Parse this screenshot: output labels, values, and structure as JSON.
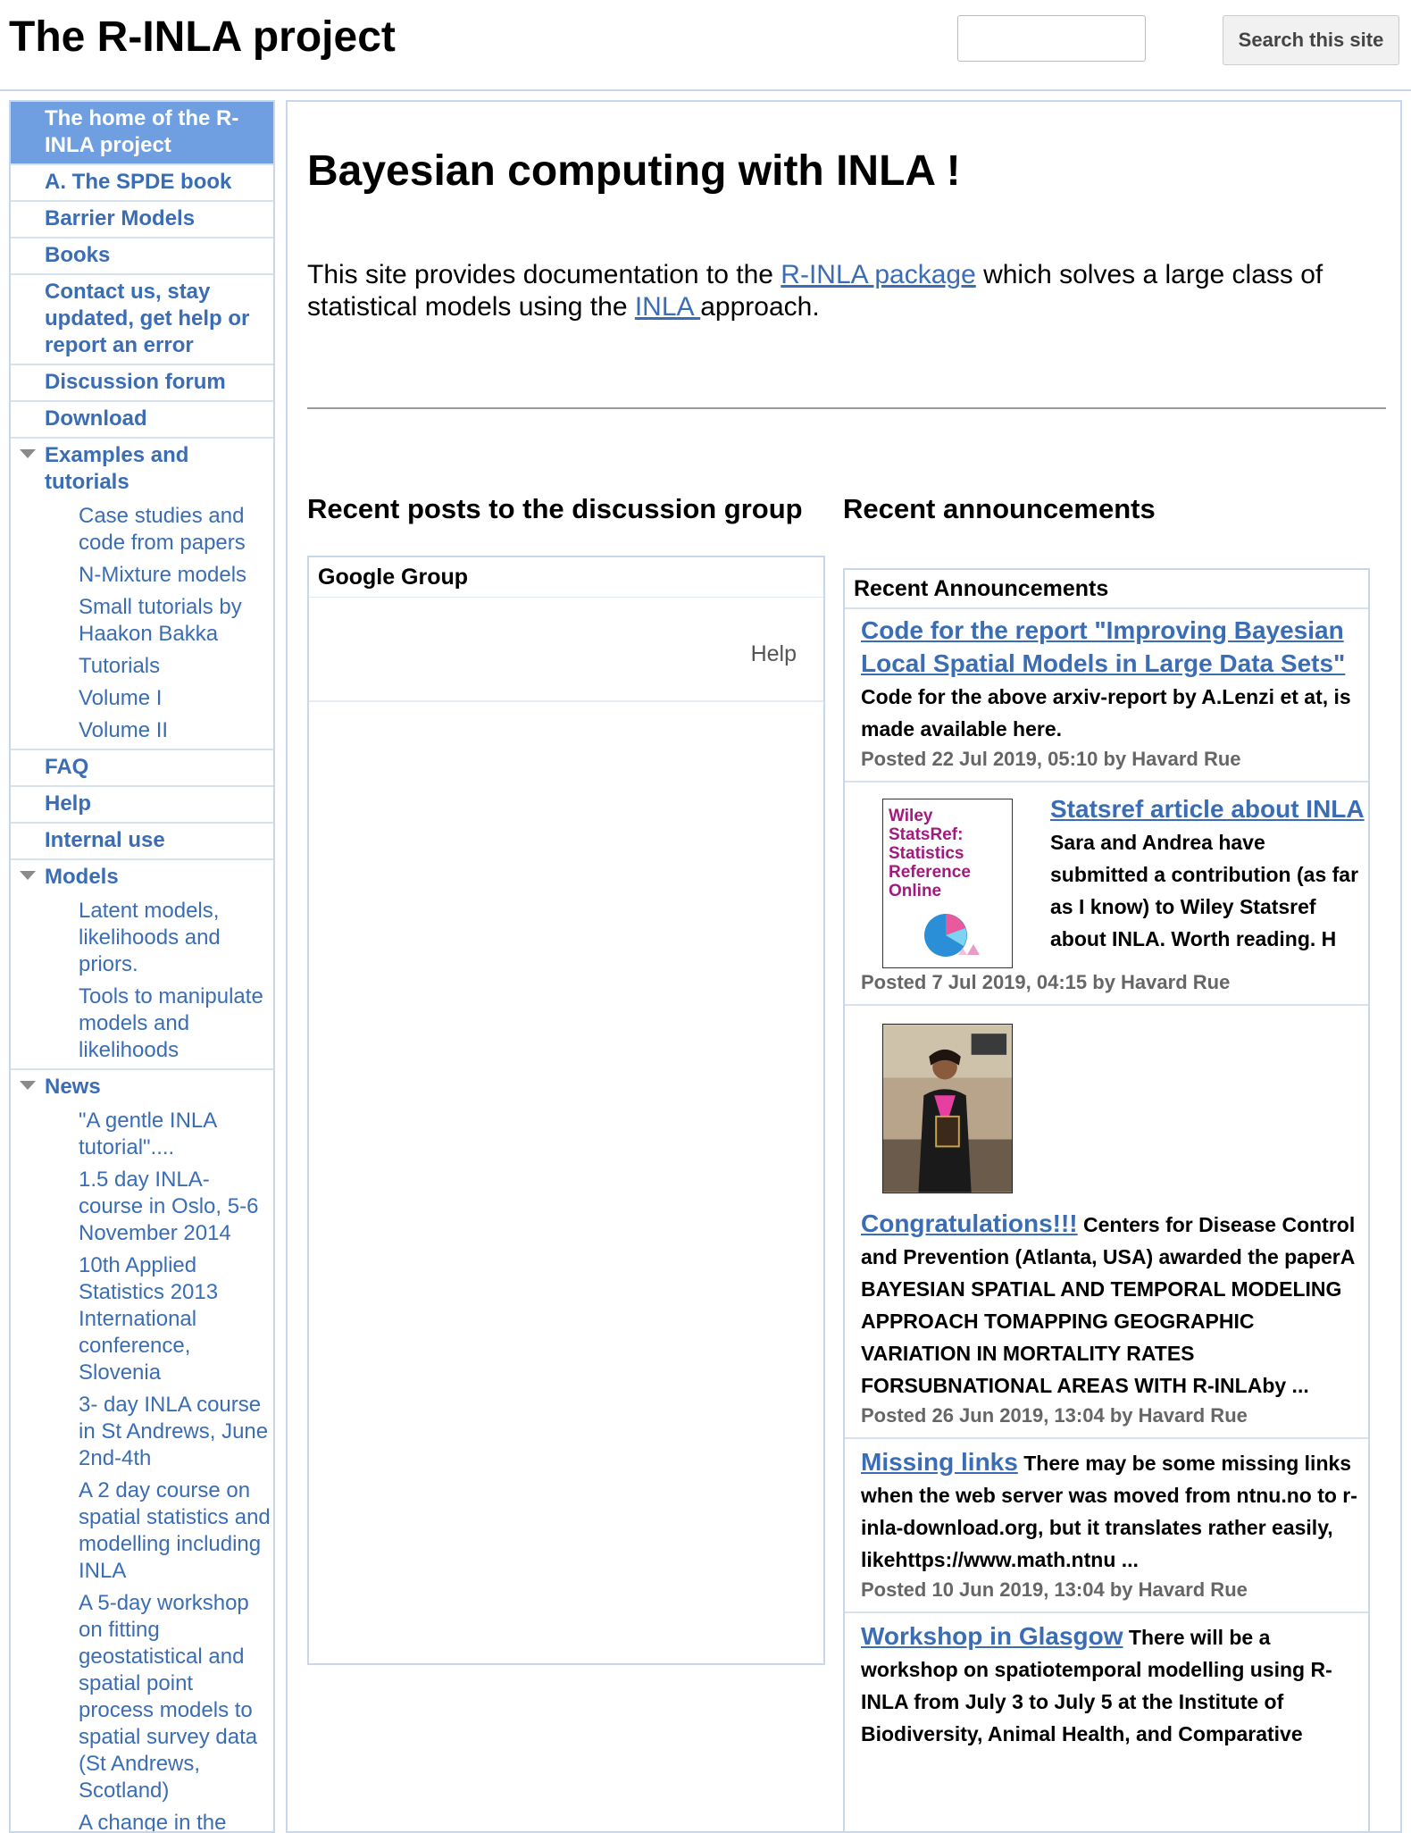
{
  "site": {
    "title": "The R-INLA project"
  },
  "search": {
    "placeholder": "",
    "button": "Search this site"
  },
  "sidebar": {
    "items": [
      {
        "label": "The home of the R-INLA project"
      },
      {
        "label": "A. The SPDE book"
      },
      {
        "label": "Barrier Models"
      },
      {
        "label": "Books"
      },
      {
        "label": "Contact us, stay updated, get help or report an error"
      },
      {
        "label": "Discussion forum"
      },
      {
        "label": "Download"
      },
      {
        "label": "Examples and tutorials",
        "children": [
          "Case studies and code from papers",
          "N-Mixture models",
          "Small tutorials by Haakon Bakka",
          "Tutorials",
          "Volume I",
          "Volume II"
        ]
      },
      {
        "label": "FAQ"
      },
      {
        "label": "Help"
      },
      {
        "label": "Internal use"
      },
      {
        "label": "Models",
        "children": [
          "Latent models, likelihoods and priors.",
          "Tools to manipulate models and likelihoods"
        ]
      },
      {
        "label": "News",
        "children": [
          "\"A gentle INLA tutorial\"....",
          "1.5 day INLA-course in Oslo, 5-6 November 2014",
          "10th Applied Statistics 2013 International conference, Slovenia",
          "3- day INLA course in St Andrews, June 2nd-4th",
          "A 2 day course on spatial statistics and modelling including INLA",
          "A 5-day workshop on fitting geostatistical and spatial point process models to spatial survey data (St Andrews, Scotland)",
          "A change in the Weibull-likelihood (from version"
        ]
      }
    ]
  },
  "main": {
    "title": "Bayesian computing with INLA !",
    "intro": {
      "before": "This site provides documentation to the ",
      "link1": "R-INLA package",
      "middle": " which solves a large class of statistical models using the ",
      "link2": "INLA ",
      "after": "approach."
    },
    "posts_heading": "Recent posts to the discussion group",
    "announcements_heading": "Recent announcements",
    "google_group": {
      "title": "Google Group",
      "help": "Help"
    },
    "announcements": {
      "title": "Recent Announcements",
      "items": [
        {
          "link": "Code for the report \"Improving Bayesian Local Spatial Models in Large Data Sets\"",
          "text": " Code for the above arxiv-report by A.Lenzi et at, is made available here.",
          "meta": "Posted 22 Jul 2019, 05:10 by Havard Rue"
        },
        {
          "link": "Statsref article about INLA",
          "text": " Sara and Andrea have submitted a contribution (as far as I know) to Wiley Statsref about INLA. Worth reading. H",
          "meta": "Posted 7 Jul 2019, 04:15 by Havard Rue",
          "thumb_text": "Wiley StatsRef: Statistics Reference Online"
        },
        {
          "link": "Congratulations!!!",
          "text": " Centers for Disease Control and Prevention (Atlanta, USA) awarded the paperA BAYESIAN SPATIAL AND TEMPORAL MODELING APPROACH TOMAPPING GEOGRAPHIC VARIATION IN MORTALITY RATES FORSUBNATIONAL AREAS WITH R-INLAby ...",
          "meta": "Posted 26 Jun 2019, 13:04 by Havard Rue"
        },
        {
          "link": "Missing links",
          "text": " There may be some missing links when the web server was moved from ntnu.no to r-inla-download.org, but it translates rather easily, likehttps://www.math.ntnu ...",
          "meta": "Posted 10 Jun 2019, 13:04 by Havard Rue"
        },
        {
          "link": "Workshop in Glasgow",
          "text": " There will be a workshop on spatiotemporal modelling using R-INLA from July 3 to July 5 at the Institute of Biodiversity, Animal Health, and Comparative",
          "meta": ""
        }
      ]
    }
  },
  "colors": {
    "link": "#3b6db5",
    "active_nav": "#6f9fe0",
    "border": "#c9d7ea"
  }
}
